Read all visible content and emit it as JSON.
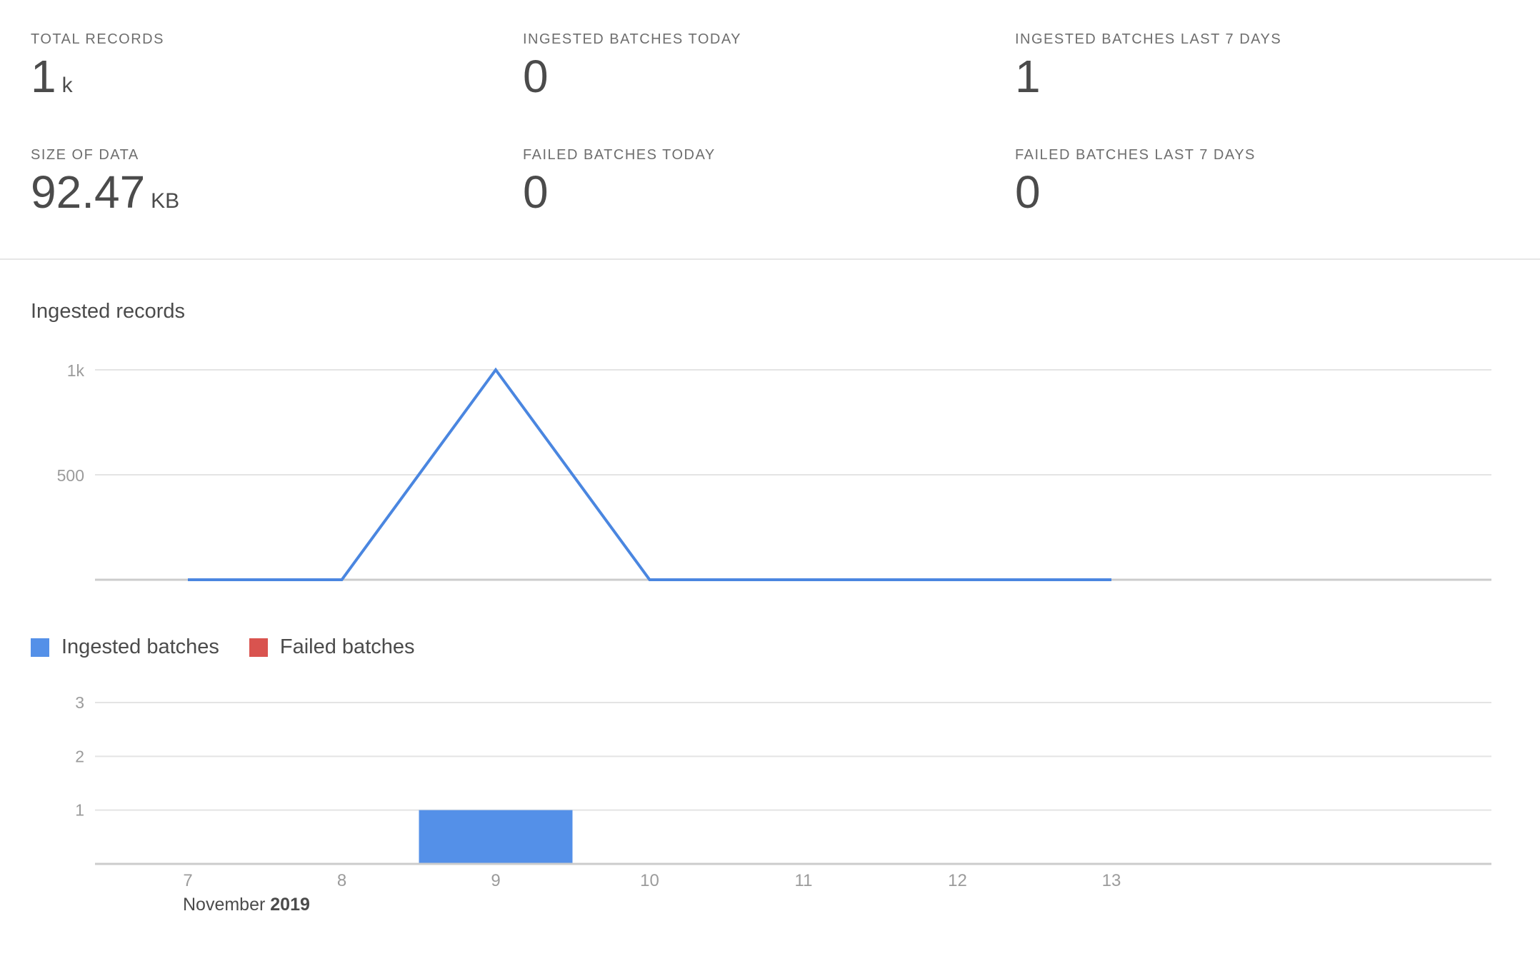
{
  "metrics": {
    "total_records": {
      "label": "TOTAL RECORDS",
      "value": "1",
      "unit": "k"
    },
    "ingested_today": {
      "label": "INGESTED BATCHES TODAY",
      "value": "0"
    },
    "ingested_7days": {
      "label": "INGESTED BATCHES LAST 7 DAYS",
      "value": "1"
    },
    "size_of_data": {
      "label": "SIZE OF DATA",
      "value": "92.47",
      "unit": "KB"
    },
    "failed_today": {
      "label": "FAILED BATCHES TODAY",
      "value": "0"
    },
    "failed_7days": {
      "label": "FAILED BATCHES LAST 7 DAYS",
      "value": "0"
    }
  },
  "chart_data": [
    {
      "type": "line",
      "title": "Ingested records",
      "x": [
        7,
        8,
        9,
        10,
        11,
        12,
        13
      ],
      "ylim": [
        0,
        1000
      ],
      "y_ticks": [
        {
          "value": 500,
          "label": "500"
        },
        {
          "value": 1000,
          "label": "1k"
        }
      ],
      "series": [
        {
          "values": [
            0,
            0,
            1000,
            0,
            0,
            0,
            0
          ],
          "color": "#4a86e0"
        }
      ],
      "grid": true
    },
    {
      "type": "bar",
      "categories": [
        "7",
        "8",
        "9",
        "10",
        "11",
        "12",
        "13"
      ],
      "ylim": [
        0,
        3
      ],
      "y_ticks": [
        {
          "value": 1,
          "label": "1"
        },
        {
          "value": 2,
          "label": "2"
        },
        {
          "value": 3,
          "label": "3"
        }
      ],
      "series": [
        {
          "name": "Ingested batches",
          "values": [
            0,
            0,
            1,
            0,
            0,
            0,
            0
          ],
          "color": "#5490e8"
        },
        {
          "name": "Failed batches",
          "values": [
            0,
            0,
            0,
            0,
            0,
            0,
            0
          ],
          "color": "#d9534f"
        }
      ],
      "legend": "top-left",
      "x_axis_month": "November",
      "x_axis_year": "2019",
      "grid": true
    }
  ],
  "colors": {
    "line": "#4a86e0",
    "ingested": "#5490e8",
    "failed": "#d9534f",
    "grid": "#e4e4e4",
    "axis": "#cccccc",
    "tick_text": "#9b9b9b"
  }
}
